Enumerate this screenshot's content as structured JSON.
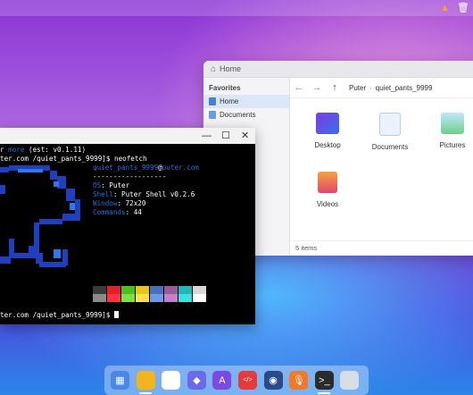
{
  "topbar": {
    "warning_icon": "warning-icon",
    "trash_icon": "trash-icon"
  },
  "explorer": {
    "title": "Home",
    "favorites_heading": "Favorites",
    "sidebar": [
      {
        "label": "Home",
        "icon": "home-icon"
      },
      {
        "label": "Documents",
        "icon": "documents-icon"
      }
    ],
    "breadcrumb": [
      "Puter",
      "quiet_pants_9999"
    ],
    "items": [
      {
        "label": "Desktop",
        "icon": "desktop-folder-icon"
      },
      {
        "label": "Documents",
        "icon": "documents-folder-icon"
      },
      {
        "label": "Pictures",
        "icon": "pictures-folder-icon"
      },
      {
        "label": "Videos",
        "icon": "videos-folder-icon"
      }
    ],
    "status": "5 items"
  },
  "terminal": {
    "lines": {
      "l1a": "r ",
      "l1b": "more",
      "l1c": " (est: v0.1.11)",
      "l2": "ter.com /quiet_pants_9999]$ neofetch",
      "user": "quiet_pants_9999",
      "at": "@",
      "host": "puter.com",
      "sep": "------------------",
      "os_label": "OS",
      "os_value": ": Puter",
      "shell_label": "Shell",
      "shell_value": ": Puter Shell v0.2.6",
      "window_label": "Window",
      "window_value": ": 72x20",
      "commands_label": "Commands",
      "commands_value": ": 44",
      "prompt": "ter.com /quiet_pants_9999]$ "
    },
    "palette": [
      "#3a3a3a",
      "#e0202a",
      "#4cc01e",
      "#e6c41d",
      "#4a6fb8",
      "#9a5a9a",
      "#22b6b6",
      "#d8d8d8",
      "#8a8a8a",
      "#ff3340",
      "#7be04a",
      "#ffe24a",
      "#6f99e8",
      "#c57fc5",
      "#3de0e0",
      "#ffffff"
    ]
  },
  "dock": {
    "items": [
      {
        "name": "app-grid-icon",
        "color": "#4a88e8"
      },
      {
        "name": "files-icon",
        "color": "#f2b51f"
      },
      {
        "name": "app-center-icon",
        "color": "#ffffff"
      },
      {
        "name": "dev-center-icon",
        "color": "#6a6ae8"
      },
      {
        "name": "font-editor-icon",
        "color": "#7b4ae0"
      },
      {
        "name": "code-editor-icon",
        "color": "#e63a3a"
      },
      {
        "name": "camera-icon",
        "color": "#2b4a8a"
      },
      {
        "name": "recorder-icon",
        "color": "#f07a2a"
      },
      {
        "name": "terminal-icon",
        "color": "#2b2b2b"
      },
      {
        "name": "trash-icon",
        "color": "#d8dee6"
      }
    ]
  }
}
